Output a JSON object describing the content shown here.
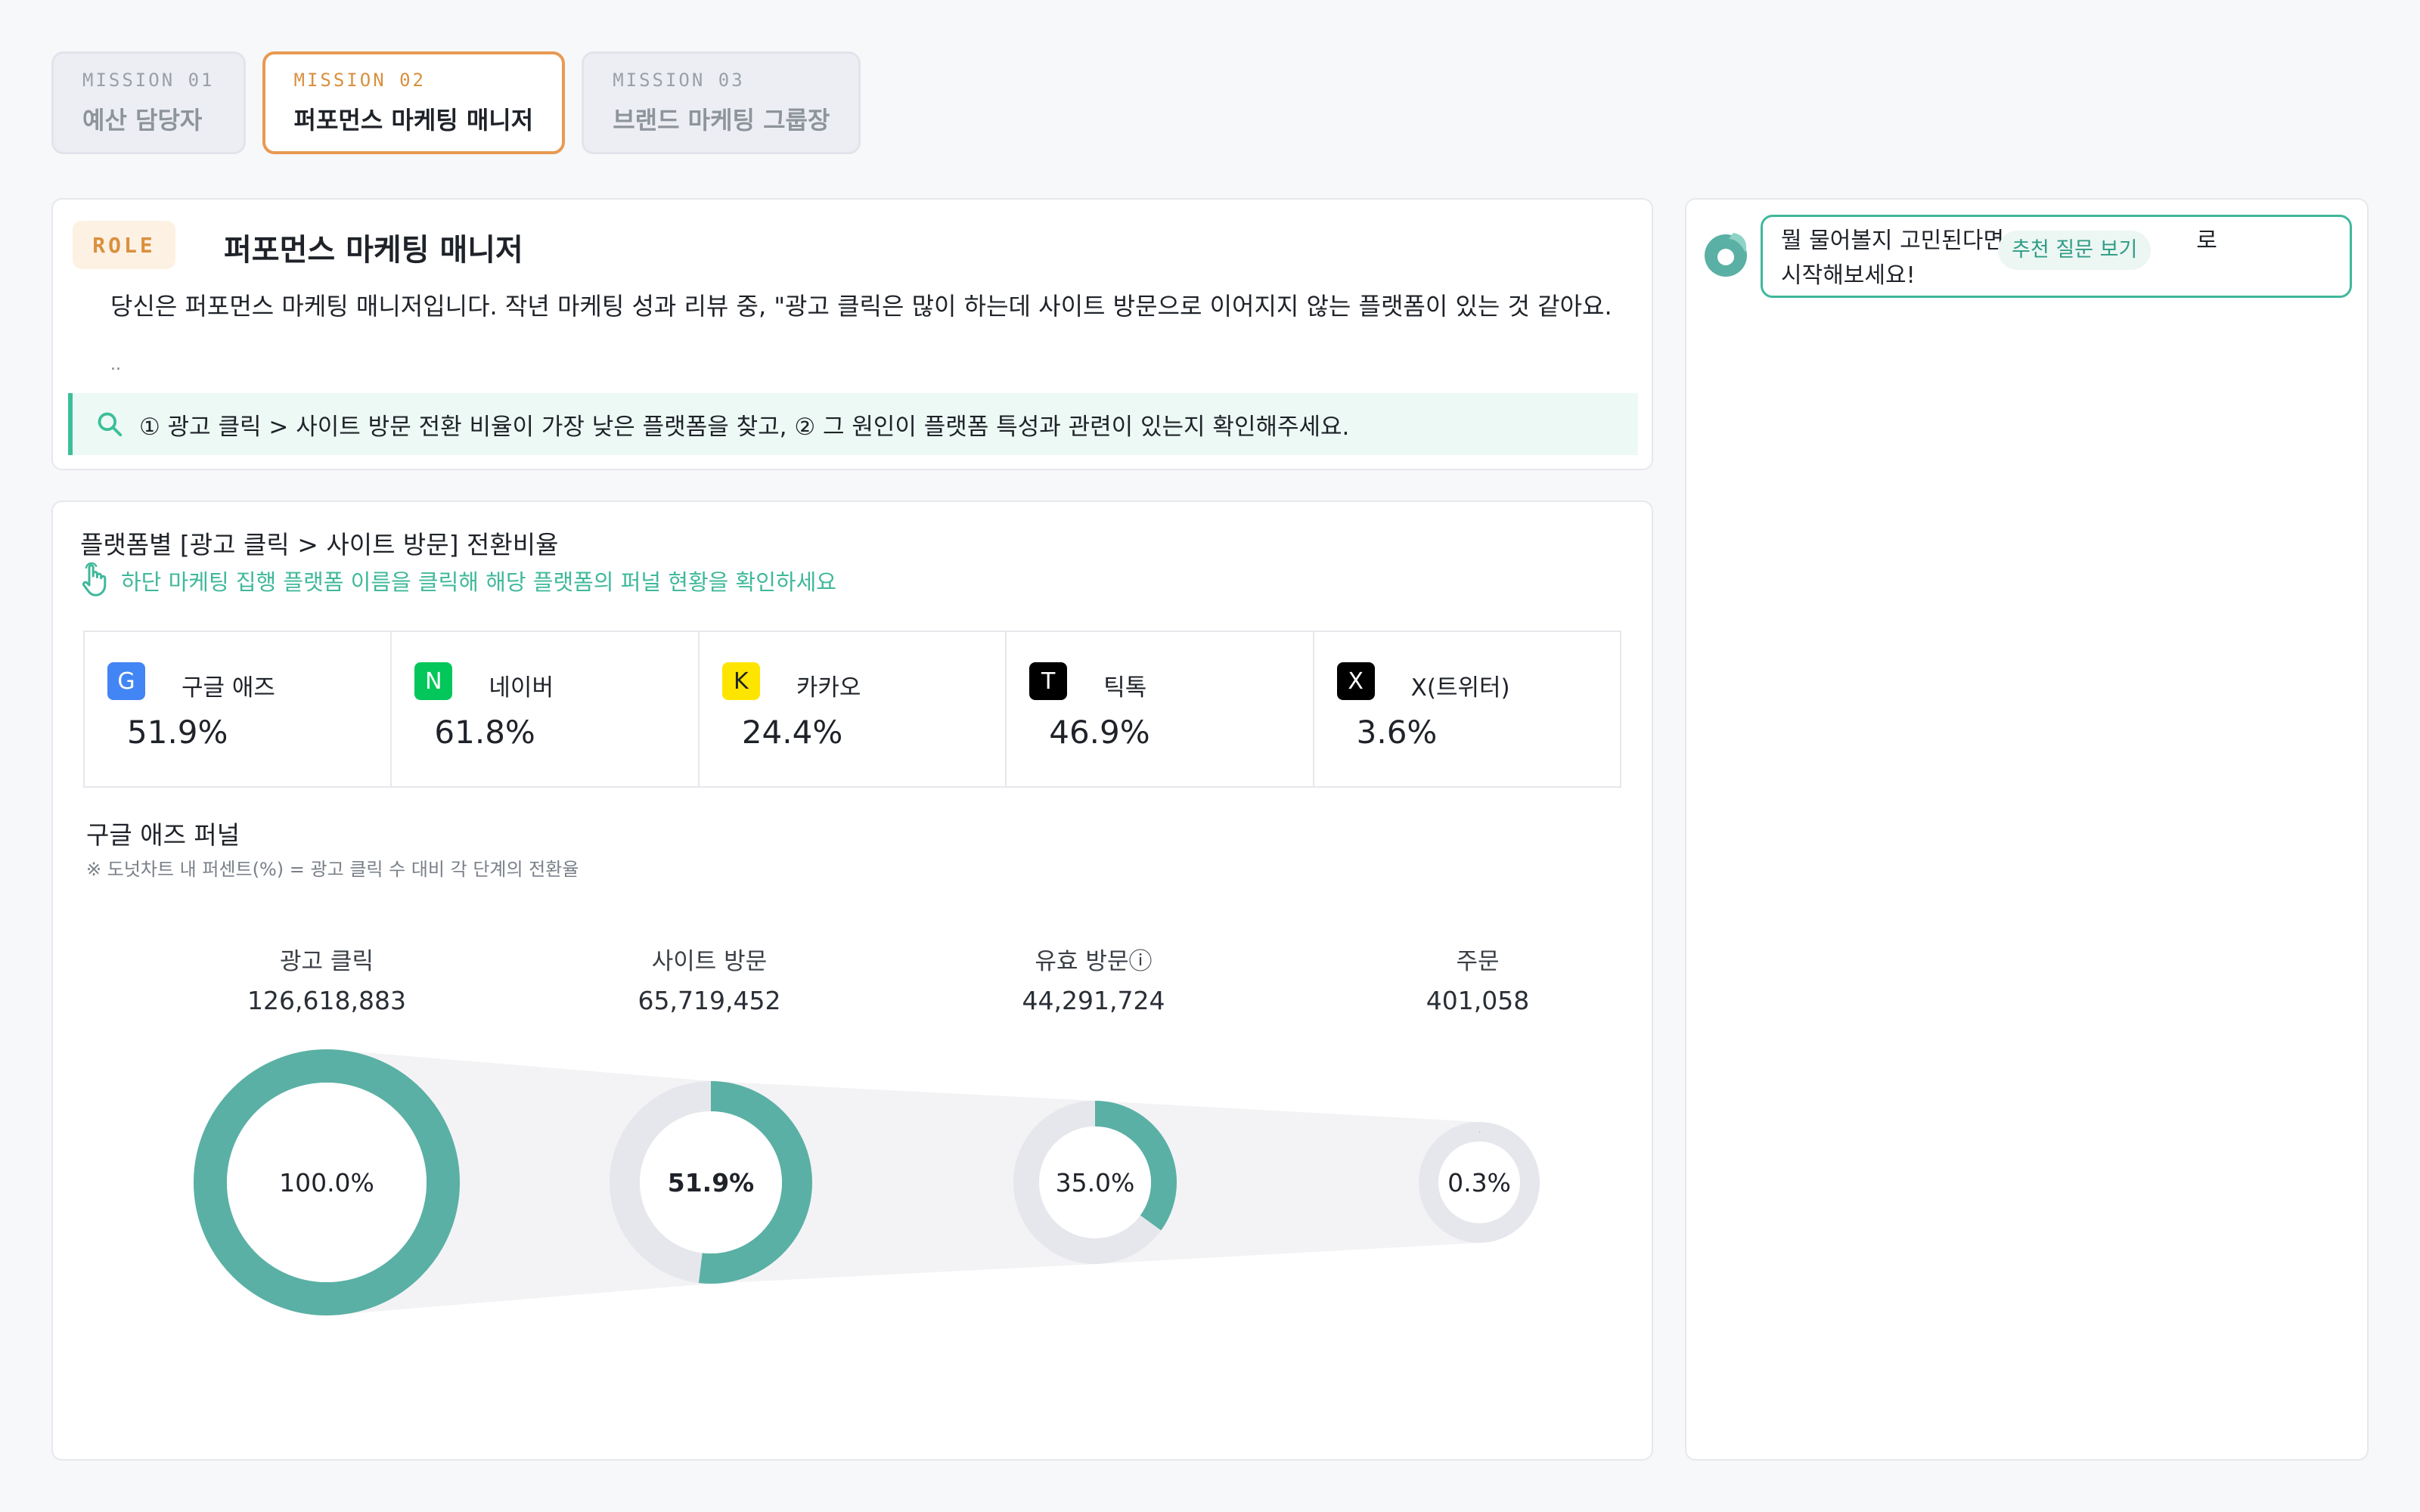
{
  "tabs": [
    {
      "code": "MISSION 01",
      "name": "예산 담당자",
      "active": false
    },
    {
      "code": "MISSION 02",
      "name": "퍼포먼스 마케팅 매니저",
      "active": true
    },
    {
      "code": "MISSION 03",
      "name": "브랜드 마케팅 그룹장",
      "active": false
    }
  ],
  "role": {
    "badge": "ROLE",
    "title": "퍼포먼스 마케팅 매니저",
    "description": "당신은 퍼포먼스 마케팅 매니저입니다. 작년 마케팅 성과 리뷰 중, \"광고 클릭은 많이 하는데 사이트 방문으로 이어지지 않는 플랫폼이 있는 것 같아요.",
    "ellipsis": "..",
    "quest": "① 광고 클릭 > 사이트 방문 전환 비율이 가장 낮은 플랫폼을 찾고, ② 그 원인이 플랫폼 특성과 관련이 있는지 확인해주세요."
  },
  "section": {
    "title": "플랫폼별 [광고 클릭 > 사이트 방문] 전환비율",
    "hint": "하단 마케팅 집행 플랫폼 이름을 클릭해 해당 플랫폼의 퍼널 현황을 확인하세요"
  },
  "platforms": [
    {
      "badge": "G",
      "name": "구글 애즈",
      "value": "51.9%",
      "color": "#4285f4",
      "text_color": "#ffffff"
    },
    {
      "badge": "N",
      "name": "네이버",
      "value": "61.8%",
      "color": "#03c75a",
      "text_color": "#ffffff"
    },
    {
      "badge": "K",
      "name": "카카오",
      "value": "24.4%",
      "color": "#fee500",
      "text_color": "#1f2329"
    },
    {
      "badge": "T",
      "name": "틱톡",
      "value": "46.9%",
      "color": "#000000",
      "text_color": "#ffffff"
    },
    {
      "badge": "X",
      "name": "X(트위터)",
      "value": "3.6%",
      "color": "#000000",
      "text_color": "#ffffff"
    }
  ],
  "funnel": {
    "title": "구글 애즈 퍼널",
    "note": "※ 도넛차트 내 퍼센트(%) =  광고 클릭 수 대비 각 단계의 전환율",
    "accent": "#5ab0a5",
    "track": "#e6e7ec"
  },
  "chart_data": {
    "type": "funnel",
    "stages": [
      {
        "label": "광고 클릭",
        "count": "126,618,883",
        "percent": 100.0,
        "percent_label": "100.0%"
      },
      {
        "label": "사이트 방문",
        "count": "65,719,452",
        "percent": 51.9,
        "percent_label": "51.9%"
      },
      {
        "label": "유효 방문ⓘ",
        "count": "44,291,724",
        "percent": 35.0,
        "percent_label": "35.0%"
      },
      {
        "label": "주문",
        "count": "401,058",
        "percent": 0.3,
        "percent_label": "0.3%"
      }
    ]
  },
  "chat": {
    "message_start": "뭘 물어볼지 고민된다면",
    "suggest_button": "추천 질문 보기",
    "message_tail": "로",
    "message_line2": "시작해보세요!"
  }
}
